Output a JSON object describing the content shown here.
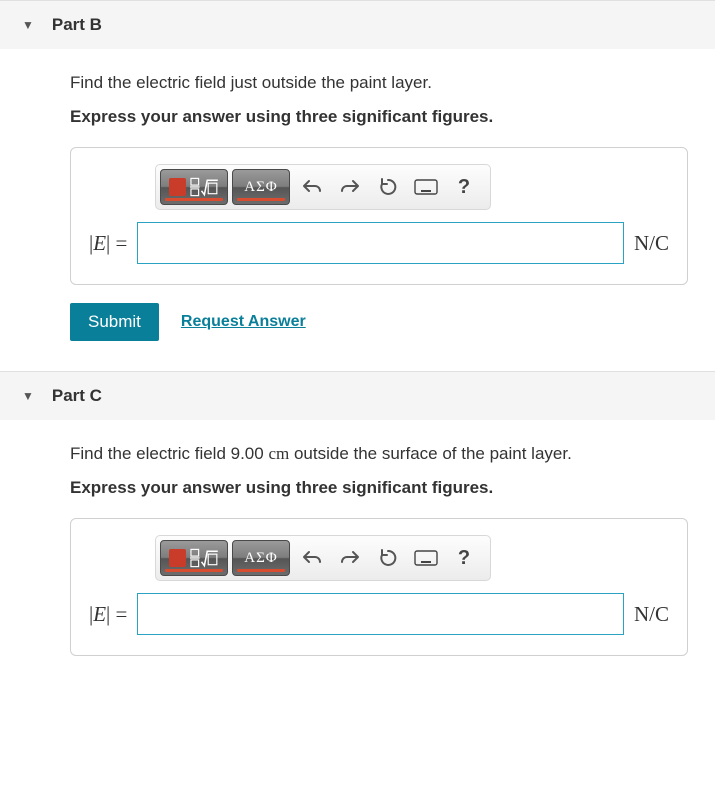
{
  "partB": {
    "title": "Part B",
    "prompt": "Find the electric field just outside the paint layer.",
    "instruction": "Express your answer using three significant figures.",
    "lhs_sym": "E",
    "eq": " = ",
    "unit": "N/C",
    "input_value": "",
    "submit": "Submit",
    "request": "Request Answer"
  },
  "partC": {
    "title": "Part C",
    "prompt_pre": "Find the electric field 9.00 ",
    "prompt_unit": "cm",
    "prompt_post": " outside the surface of the paint layer.",
    "instruction": "Express your answer using three significant figures.",
    "lhs_sym": "E",
    "eq": " = ",
    "unit": "N/C",
    "input_value": ""
  },
  "toolbar": {
    "symbols_label": "ΑΣΦ",
    "help_label": "?"
  }
}
